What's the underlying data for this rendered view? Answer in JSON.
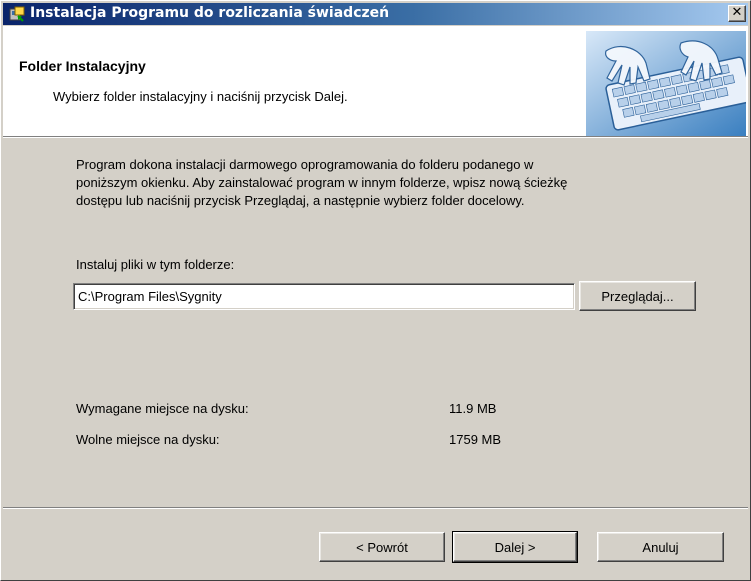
{
  "window": {
    "title": "Instalacja Programu do rozliczania świadczeń",
    "close_label": "✕"
  },
  "header": {
    "title": "Folder Instalacyjny",
    "subtitle": "Wybierz folder instalacyjny i naciśnij przycisk Dalej.",
    "image": "keyboard-hands-image"
  },
  "main": {
    "description_line1": "Program dokona instalacji darmowego oprogramowania do folderu podanego w",
    "description_line2": "poniższym okienku. Aby zainstalować program w innym folderze, wpisz nową ścieżkę",
    "description_line3": "dostępu lub naciśnij przycisk Przeglądaj, a następnie wybierz folder docelowy.",
    "install_label": "Instaluj pliki w tym folderze:",
    "install_path": "C:\\Program Files\\Sygnity",
    "browse_label": "Przeglądaj...",
    "required_space_label": "Wymagane miejsce na dysku:",
    "required_space_value": "11.9 MB",
    "free_space_label": "Wolne miejsce na dysku:",
    "free_space_value": "1759 MB"
  },
  "footer": {
    "back_label": "< Powrót",
    "next_label": "Dalej >",
    "cancel_label": "Anuluj"
  },
  "colors": {
    "titlebar_start": "#0a246a",
    "titlebar_end": "#a6caf0",
    "face": "#d4d0c8",
    "header_bg": "#ffffff"
  }
}
